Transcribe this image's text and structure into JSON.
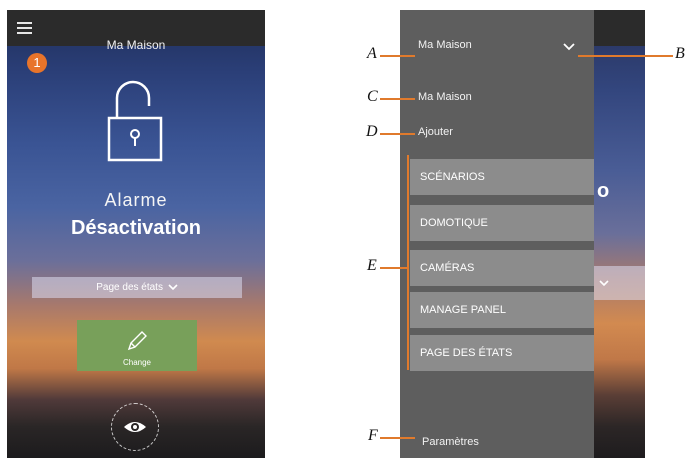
{
  "left_screen": {
    "title": "Ma Maison",
    "badge_number": "1",
    "alarm_label": "Alarme",
    "alarm_state": "Désactivation",
    "status_dropdown": "Page des états",
    "change_button": "Change"
  },
  "right_screen": {
    "home_selector": "Ma Maison",
    "home_item": "Ma Maison",
    "add_item": "Ajouter",
    "menu_items": [
      {
        "label": "SCÉNARIOS"
      },
      {
        "label": "DOMOTIQUE"
      },
      {
        "label": "CAMÉRAS"
      },
      {
        "label": "MANAGE PANEL"
      },
      {
        "label": "PAGE DES ÉTATS"
      }
    ],
    "settings": "Paramètres"
  },
  "callouts": {
    "a": "A",
    "b": "B",
    "c": "C",
    "d": "D",
    "e": "E",
    "f": "F"
  },
  "colors": {
    "callout_orange": "#e07a2c",
    "badge_orange": "#e8742a",
    "change_green": "#78a05a",
    "drawer_gray": "#5e5e5e",
    "menu_item_gray": "#8c8c8c"
  }
}
